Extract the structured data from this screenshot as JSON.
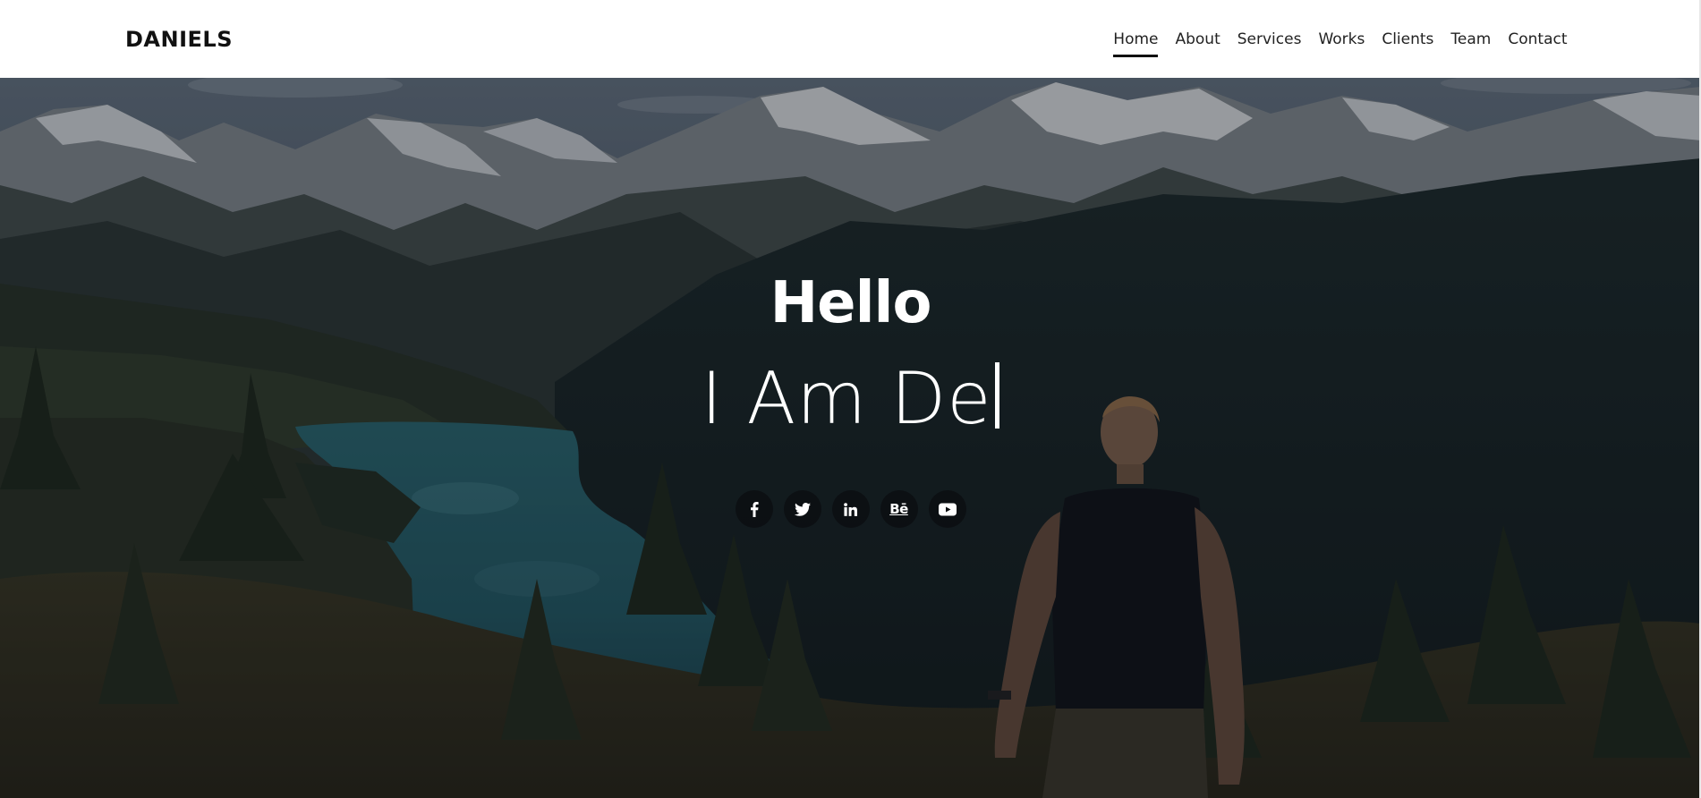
{
  "brand": "DANIELS",
  "nav": {
    "items": [
      "Home",
      "About",
      "Services",
      "Works",
      "Clients",
      "Team",
      "Contact"
    ],
    "active": "Home"
  },
  "hero": {
    "greeting": "Hello",
    "typed_text": "I Am De",
    "background": "mountain-lake-landscape-with-man",
    "social": [
      {
        "name": "facebook",
        "icon": "facebook-icon"
      },
      {
        "name": "twitter",
        "icon": "twitter-icon"
      },
      {
        "name": "linkedin",
        "icon": "linkedin-icon"
      },
      {
        "name": "behance",
        "icon": "behance-icon",
        "glyph": "Bē"
      },
      {
        "name": "youtube",
        "icon": "youtube-icon"
      }
    ]
  },
  "colors": {
    "header_bg": "#ffffff",
    "text_dark": "#111111",
    "hero_overlay": "#0a0e14",
    "hero_text": "#ffffff"
  }
}
